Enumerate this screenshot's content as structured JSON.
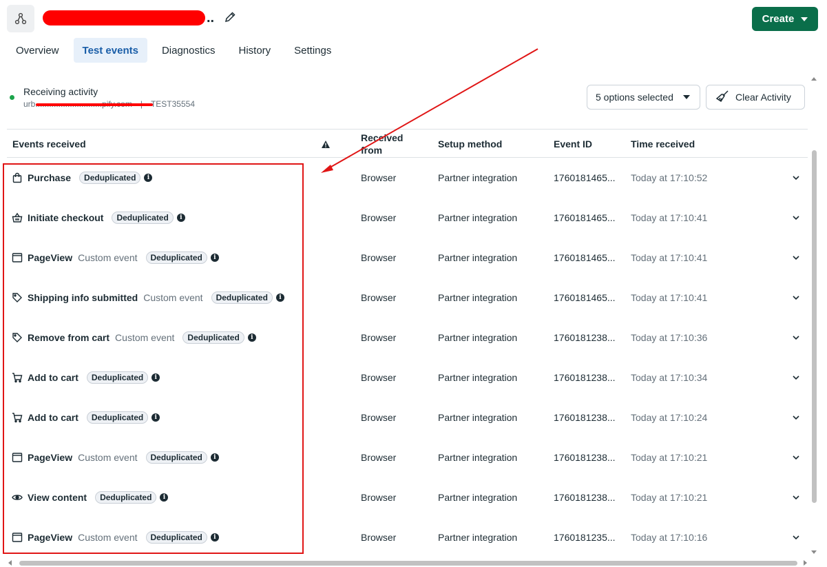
{
  "header": {
    "title_suffix": "..",
    "create_label": "Create"
  },
  "tabs": [
    {
      "label": "Overview",
      "active": false
    },
    {
      "label": "Test events",
      "active": true
    },
    {
      "label": "Diagnostics",
      "active": false
    },
    {
      "label": "History",
      "active": false
    },
    {
      "label": "Settings",
      "active": false
    }
  ],
  "activity": {
    "title": "Receiving activity",
    "domain": "urb.............................pify.com",
    "separator": "|",
    "code": "TEST35554"
  },
  "filters": {
    "options_label": "5 options selected",
    "clear_label": "Clear Activity"
  },
  "table": {
    "headers": {
      "events": "Events received",
      "received": "Received from",
      "setup": "Setup method",
      "event_id": "Event ID",
      "time": "Time received"
    },
    "badge_label": "Deduplicated",
    "rows": [
      {
        "icon": "shopping-bag-icon",
        "name": "Purchase",
        "sub": "",
        "received": "Browser",
        "setup": "Partner integration",
        "event_id": "1760181465...",
        "time": "Today at 17:10:52"
      },
      {
        "icon": "basket-icon",
        "name": "Initiate checkout",
        "sub": "",
        "received": "Browser",
        "setup": "Partner integration",
        "event_id": "1760181465...",
        "time": "Today at 17:10:41"
      },
      {
        "icon": "browser-window-icon",
        "name": "PageView",
        "sub": "Custom event",
        "received": "Browser",
        "setup": "Partner integration",
        "event_id": "1760181465...",
        "time": "Today at 17:10:41"
      },
      {
        "icon": "tag-icon",
        "name": "Shipping info submitted",
        "sub": "Custom event",
        "received": "Browser",
        "setup": "Partner integration",
        "event_id": "1760181465...",
        "time": "Today at 17:10:41"
      },
      {
        "icon": "tag-icon",
        "name": "Remove from cart",
        "sub": "Custom event",
        "received": "Browser",
        "setup": "Partner integration",
        "event_id": "1760181238...",
        "time": "Today at 17:10:36"
      },
      {
        "icon": "cart-icon",
        "name": "Add to cart",
        "sub": "",
        "received": "Browser",
        "setup": "Partner integration",
        "event_id": "1760181238...",
        "time": "Today at 17:10:34"
      },
      {
        "icon": "cart-icon",
        "name": "Add to cart",
        "sub": "",
        "received": "Browser",
        "setup": "Partner integration",
        "event_id": "1760181238...",
        "time": "Today at 17:10:24"
      },
      {
        "icon": "browser-window-icon",
        "name": "PageView",
        "sub": "Custom event",
        "received": "Browser",
        "setup": "Partner integration",
        "event_id": "1760181238...",
        "time": "Today at 17:10:21"
      },
      {
        "icon": "eye-icon",
        "name": "View content",
        "sub": "",
        "received": "Browser",
        "setup": "Partner integration",
        "event_id": "1760181238...",
        "time": "Today at 17:10:21"
      },
      {
        "icon": "browser-window-icon",
        "name": "PageView",
        "sub": "Custom event",
        "received": "Browser",
        "setup": "Partner integration",
        "event_id": "1760181235...",
        "time": "Today at 17:10:16"
      }
    ]
  },
  "colors": {
    "create_bg": "#0a6e4a",
    "active_tab_bg": "#e7f0fa",
    "active_tab_text": "#1a5ea8",
    "annotation_red": "#e01515",
    "status_green": "#1ca44b"
  }
}
